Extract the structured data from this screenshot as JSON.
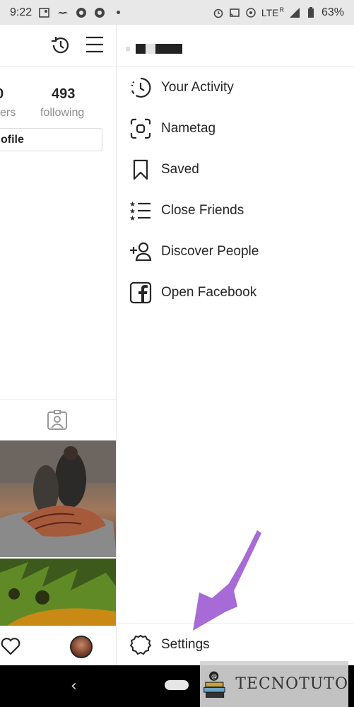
{
  "status_bar": {
    "time": "9:22",
    "network": "LTE",
    "roaming": "R",
    "battery": "63%",
    "icons": [
      "maps-icon",
      "mustache-icon",
      "aperture-icon",
      "aperture-icon",
      "alarm-icon",
      "cast-icon",
      "hotspot-icon",
      "signal-icon",
      "battery-icon"
    ]
  },
  "profile": {
    "followers_count": "0",
    "followers_label": "ers",
    "following_count": "493",
    "following_label": "following",
    "edit_profile_label": "ofile"
  },
  "drawer": {
    "menu_items": [
      {
        "label": "Your Activity",
        "icon": "activity-icon"
      },
      {
        "label": "Nametag",
        "icon": "nametag-icon"
      },
      {
        "label": "Saved",
        "icon": "bookmark-icon"
      },
      {
        "label": "Close Friends",
        "icon": "close-friends-icon"
      },
      {
        "label": "Discover People",
        "icon": "add-person-icon"
      },
      {
        "label": "Open Facebook",
        "icon": "facebook-icon"
      }
    ],
    "settings_label": "Settings"
  },
  "watermark": {
    "text": "TECNOTUTO"
  },
  "colors": {
    "text": "#262626",
    "muted": "#8e8e8e",
    "arrow": "#a66bd6",
    "divider": "#ececec"
  }
}
